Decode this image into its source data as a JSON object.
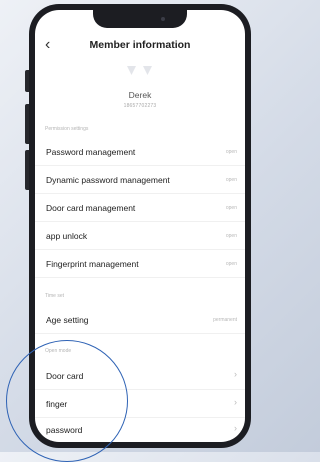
{
  "screen": {
    "title": "Member information",
    "back_icon": "chevron-left-icon"
  },
  "user": {
    "name": "Derek",
    "phone": "18657702273"
  },
  "sections": {
    "permission": "Permission settings",
    "time": "Time set",
    "open_mode": "Open mode"
  },
  "permissions": [
    {
      "label": "Password management",
      "value": "open"
    },
    {
      "label": "Dynamic password management",
      "value": "open"
    },
    {
      "label": "Door card management",
      "value": "open"
    },
    {
      "label": "app unlock",
      "value": "open"
    },
    {
      "label": "Fingerprint management",
      "value": "open"
    }
  ],
  "time_set": [
    {
      "label": "Age setting",
      "value": "permanent"
    }
  ],
  "open_modes": [
    {
      "label": "Door card",
      "icon": "chevron-right-icon"
    },
    {
      "label": "finger",
      "icon": "chevron-right-icon"
    },
    {
      "label": "password",
      "icon": "chevron-right-icon"
    }
  ],
  "colors": {
    "highlight_circle": "#2f63b5",
    "phone_body": "#1c1d22",
    "background": "#d4dbe7"
  }
}
